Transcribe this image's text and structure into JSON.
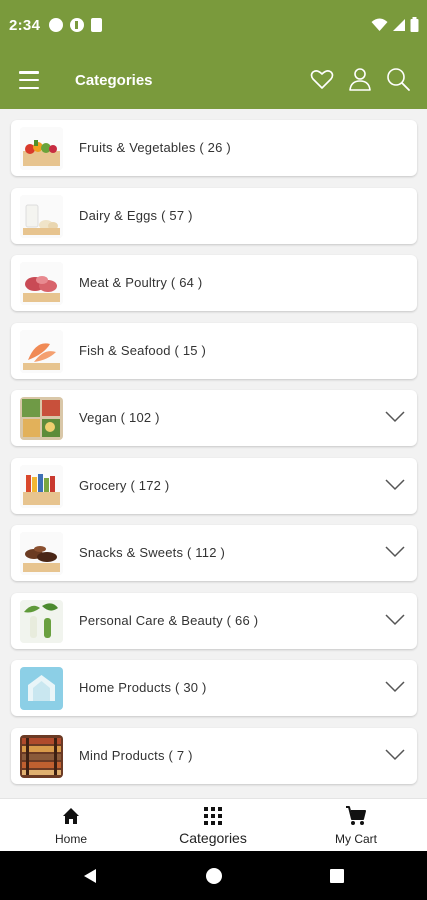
{
  "status_bar": {
    "time": "2:34"
  },
  "app_bar": {
    "title": "Categories"
  },
  "colors": {
    "brand": "#7a9a3c",
    "card": "#ffffff",
    "background": "#f2f2f2"
  },
  "categories": [
    {
      "label": "Fruits & Vegetables ( 26 )",
      "expandable": false,
      "icon": "produce-crate-icon"
    },
    {
      "label": "Dairy & Eggs ( 57 )",
      "expandable": false,
      "icon": "dairy-icon"
    },
    {
      "label": "Meat & Poultry ( 64 )",
      "expandable": false,
      "icon": "meat-icon"
    },
    {
      "label": "Fish & Seafood ( 15 )",
      "expandable": false,
      "icon": "fish-icon"
    },
    {
      "label": "Vegan ( 102 )",
      "expandable": true,
      "icon": "vegan-icon"
    },
    {
      "label": "Grocery ( 172 )",
      "expandable": true,
      "icon": "grocery-crate-icon"
    },
    {
      "label": "Snacks & Sweets ( 112 )",
      "expandable": true,
      "icon": "snacks-icon"
    },
    {
      "label": "Personal Care & Beauty ( 66 )",
      "expandable": true,
      "icon": "personal-care-icon"
    },
    {
      "label": "Home Products ( 30 )",
      "expandable": true,
      "icon": "home-icon"
    },
    {
      "label": "Mind Products ( 7 )",
      "expandable": true,
      "icon": "books-icon"
    }
  ],
  "bottom_nav": {
    "home": "Home",
    "categories": "Categories",
    "cart": "My Cart"
  }
}
